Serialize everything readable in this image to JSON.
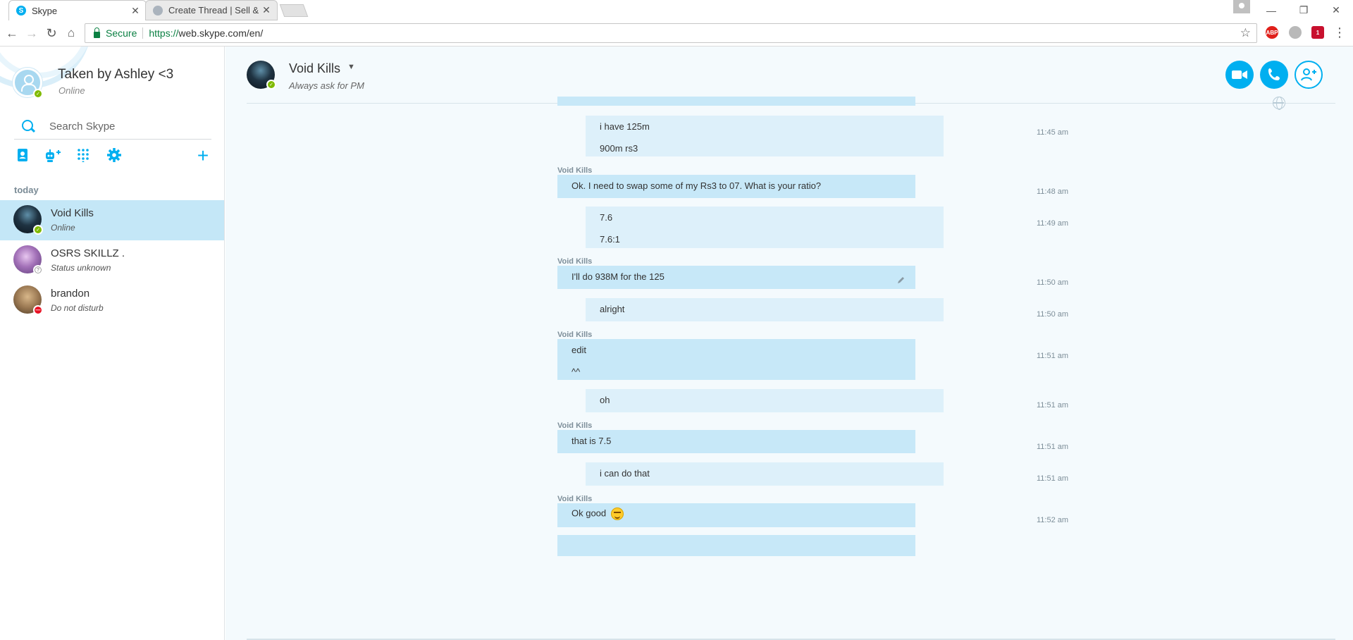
{
  "browser": {
    "tabs": [
      {
        "title": "Skype",
        "close": "✕",
        "active": true
      },
      {
        "title": "Create Thread | Sell & Tr",
        "close": "✕",
        "active": false
      }
    ],
    "secure_label": "Secure",
    "url_scheme": "https://",
    "url_rest": "web.skype.com/en/",
    "extensions": [
      {
        "name": "adblock-plus",
        "label": "ABP",
        "color": "#e0201b"
      },
      {
        "name": "extension-gray",
        "label": "",
        "color": "#b9b9b9"
      },
      {
        "name": "extension-red-badge",
        "label": "1",
        "color": "#c8102e"
      }
    ]
  },
  "sidebar": {
    "me": {
      "name": "Taken by Ashley <3",
      "status": "Online"
    },
    "search": {
      "placeholder": "Search Skype"
    },
    "tools": [
      "contacts-icon",
      "add-bot-icon",
      "dialpad-icon",
      "settings-icon",
      "add-icon"
    ],
    "section_label": "today",
    "contacts": [
      {
        "name": "Void Kills",
        "status": "Online",
        "presence": "online",
        "selected": true
      },
      {
        "name": "OSRS SKILLZ .",
        "status": "Status unknown",
        "presence": "unknown",
        "selected": false
      },
      {
        "name": "brandon",
        "status": "Do not disturb",
        "presence": "dnd",
        "selected": false
      }
    ]
  },
  "conversation": {
    "name": "Void Kills",
    "mood": "Always ask for PM",
    "actions": [
      "video-call-icon",
      "audio-call-icon",
      "add-participant-icon"
    ],
    "messages": [
      {
        "direction": "out",
        "sender": "",
        "lines": [
          "i have 125m",
          "900m rs3"
        ],
        "time": "11:45 am"
      },
      {
        "direction": "in",
        "sender": "Void Kills",
        "lines": [
          "Ok. I need to swap some of my Rs3 to 07. What is your ratio?"
        ],
        "time": "11:48 am"
      },
      {
        "direction": "out",
        "sender": "",
        "lines": [
          "7.6",
          "7.6:1"
        ],
        "time": "11:49 am"
      },
      {
        "direction": "in",
        "sender": "Void Kills",
        "lines": [
          "I'll do 938M for the 125"
        ],
        "time": "11:50 am",
        "edited": true
      },
      {
        "direction": "out",
        "sender": "",
        "lines": [
          "alright"
        ],
        "time": "11:50 am"
      },
      {
        "direction": "in",
        "sender": "Void Kills",
        "lines": [
          "edit",
          "^^"
        ],
        "time": "11:51 am"
      },
      {
        "direction": "out",
        "sender": "",
        "lines": [
          "oh"
        ],
        "time": "11:51 am"
      },
      {
        "direction": "in",
        "sender": "Void Kills",
        "lines": [
          "that is 7.5"
        ],
        "time": "11:51 am"
      },
      {
        "direction": "out",
        "sender": "",
        "lines": [
          "i can do that"
        ],
        "time": "11:51 am"
      },
      {
        "direction": "in",
        "sender": "Void Kills",
        "lines": [
          "Ok good"
        ],
        "time": "11:52 am",
        "emoji": "smile-emoji"
      }
    ]
  },
  "colors": {
    "skype_blue": "#00aff0",
    "selected_row": "#c4e7f7",
    "incoming_bubble": "#c7e8f8",
    "outgoing_bubble": "#ddf0fa",
    "online": "#7fba00",
    "dnd": "#e81123"
  }
}
